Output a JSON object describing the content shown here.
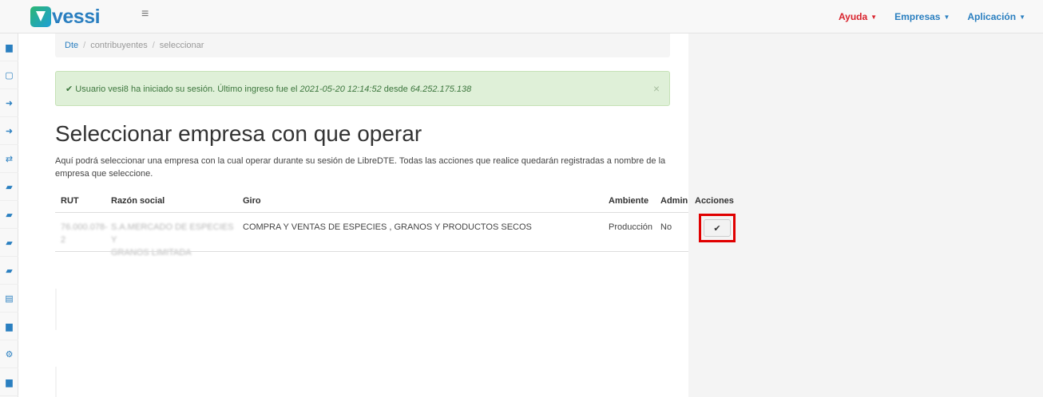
{
  "header": {
    "logo_text": "vessi",
    "menu_icon": "≡",
    "nav": [
      {
        "label": "Ayuda",
        "color": "#d9232d"
      },
      {
        "label": "Empresas",
        "color": "#2a7fc0"
      },
      {
        "label": "Aplicación",
        "color": "#2a7fc0"
      }
    ]
  },
  "sidebar": {
    "icons": [
      "file-icon",
      "file-blank-icon",
      "sign-out-icon",
      "sign-in-icon",
      "exchange-icon",
      "book-icon",
      "book-icon",
      "book-icon",
      "book-icon",
      "archive-icon",
      "file-icon",
      "cogs-icon",
      "file-icon"
    ],
    "glyphs": [
      "▆",
      "▢",
      "➜",
      "➜",
      "⇄",
      "▰",
      "▰",
      "▰",
      "▰",
      "▤",
      "▆",
      "⚙",
      "▆"
    ]
  },
  "breadcrumb": {
    "items": [
      "Dte",
      "contribuyentes",
      "seleccionar"
    ],
    "separator": "/"
  },
  "alert": {
    "check": "✔",
    "prefix": "Usuario vesi8 ha iniciado su sesión. Último ingreso fue el",
    "datetime": "2021-05-20 12:14:52",
    "middle": "desde",
    "ip": "64.252.175.138",
    "close": "×"
  },
  "page": {
    "title": "Seleccionar empresa con que operar",
    "description": "Aquí podrá seleccionar una empresa con la cual operar durante su sesión de LibreDTE. Todas las acciones que realice quedarán registradas a nombre de la empresa que seleccione."
  },
  "table": {
    "headers": {
      "rut": "RUT",
      "razon": "Razón social",
      "giro": "Giro",
      "ambiente": "Ambiente",
      "admin": "Admin",
      "acciones": "Acciones"
    },
    "rows": [
      {
        "rut_line1": "76.000.078-",
        "rut_line2": "2",
        "razon_line1": "S.A.MERCADO DE ESPECIES Y",
        "razon_line2": "GRANOS LIMITADA",
        "giro": "COMPRA Y VENTAS DE ESPECIES , GRANOS Y PRODUCTOS SECOS",
        "ambiente": "Producción",
        "admin": "No",
        "action_glyph": "✔"
      }
    ]
  },
  "colors": {
    "brand_blue": "#2a7fc0",
    "brand_red": "#d9232d",
    "alert_bg": "#dff0d8",
    "highlight": "#e00000"
  }
}
